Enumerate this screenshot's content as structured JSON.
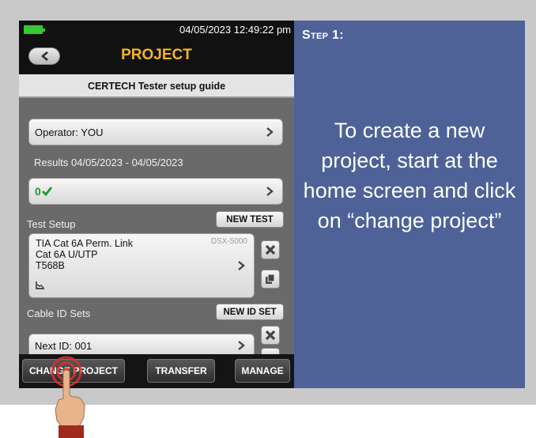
{
  "status": {
    "datetime": "04/05/2023 12:49:22 pm"
  },
  "header": {
    "title": "PROJECT"
  },
  "subtitle": "CERTECH Tester setup guide",
  "operator": {
    "label": "Operator: YOU"
  },
  "results": {
    "label": "Results 04/05/2023 - 04/05/2023",
    "count": "0"
  },
  "test_setup": {
    "section_label": "Test Setup",
    "new_button": "NEW TEST",
    "line1": "TIA Cat 6A Perm. Link",
    "line2": "Cat 6A U/UTP",
    "line3": "T568B",
    "tester": "DSX-5000"
  },
  "cable_ids": {
    "section_label": "Cable ID Sets",
    "new_button": "NEW ID SET",
    "next_id": "Next ID: 001"
  },
  "bottom_bar": {
    "change_project": "CHANGE PROJECT",
    "transfer": "TRANSFER",
    "manage": "MANAGE"
  },
  "instruction": {
    "step": "Step 1:",
    "text": "To create a new project, start at the home screen and click on “change project”"
  },
  "colors": {
    "title": "#f4b624",
    "panel": "#4e6298",
    "battery": "#36c832",
    "check": "#1c9a32"
  },
  "icons": [
    "battery-icon",
    "back-arrow-icon",
    "chevron-right-icon",
    "checkmark-icon",
    "close-icon",
    "copy-icon",
    "graph-icon",
    "hand-pointer-icon"
  ]
}
